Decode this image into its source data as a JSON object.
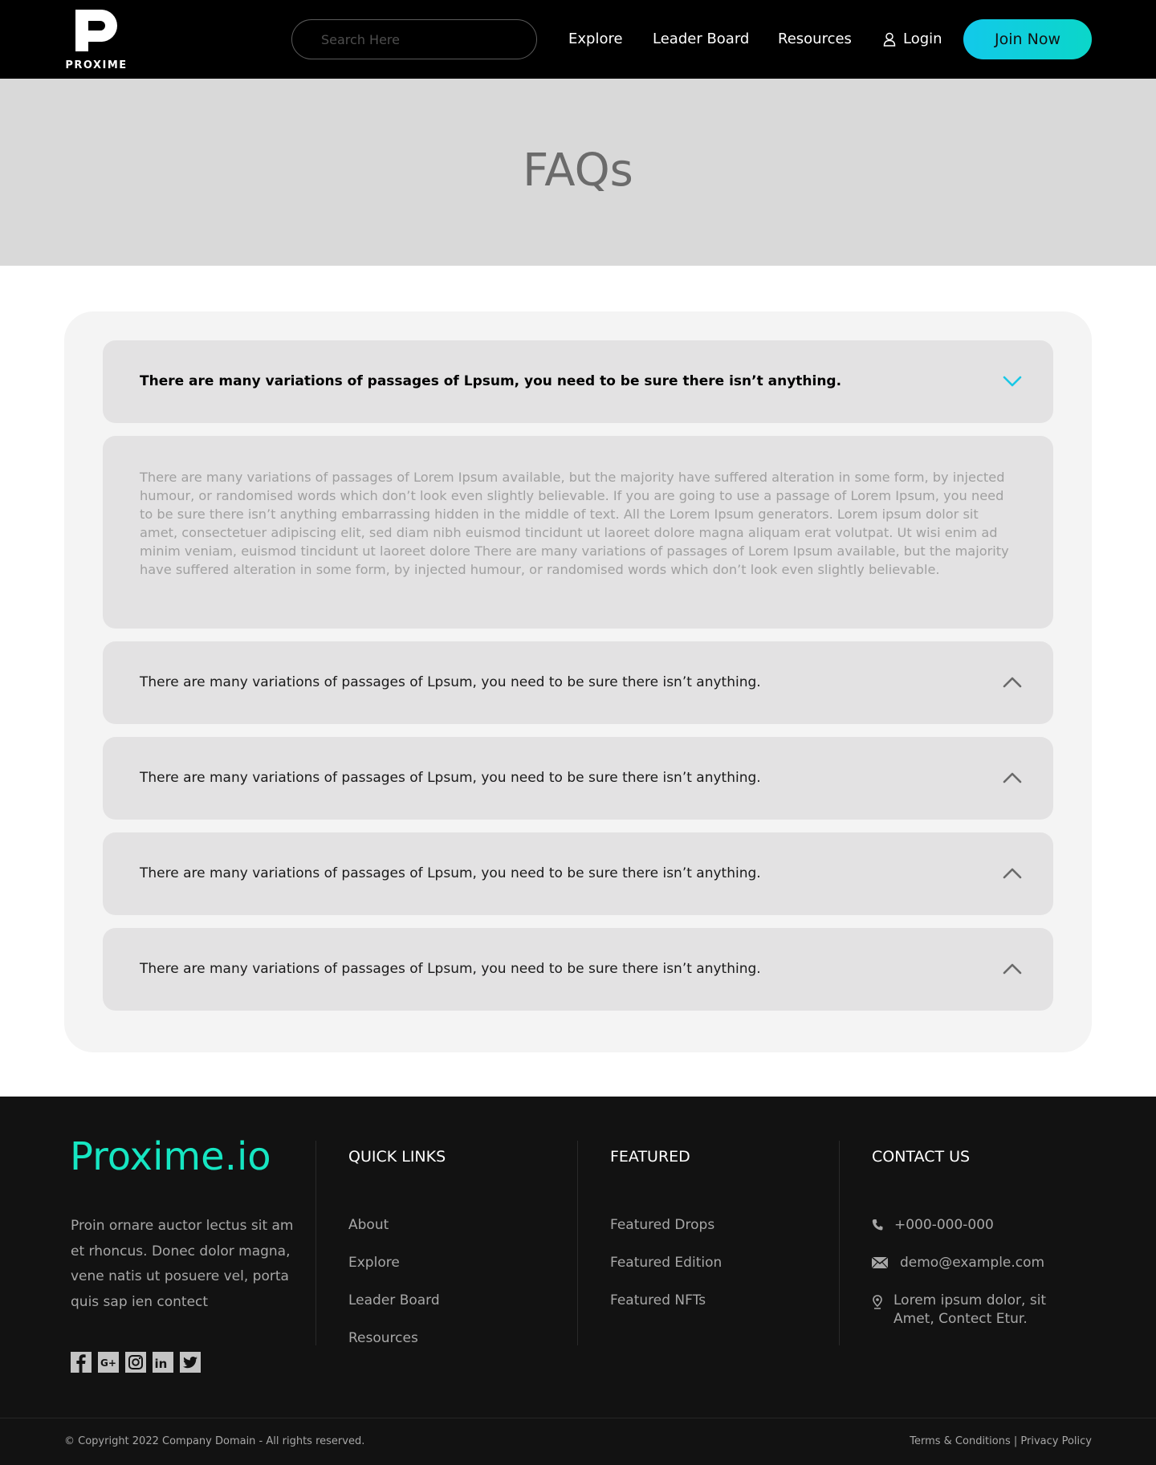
{
  "header": {
    "logo_text": "PROXIME",
    "search_placeholder": "Search Here",
    "nav": [
      "Explore",
      "Leader Board",
      "Resources"
    ],
    "login_label": "Login",
    "join_label": "Join Now"
  },
  "hero": {
    "title": "FAQs"
  },
  "faq": {
    "accent_color": "#1ac8e6",
    "items": [
      {
        "question": "There are many variations of passages of Lpsum, you need to be sure there isn’t anything.",
        "expanded": true,
        "icon": "chevron-down-icon"
      },
      {
        "question": "There are many variations of passages of Lpsum, you need to be sure there isn’t anything.",
        "expanded": false,
        "icon": "chevron-up-icon"
      },
      {
        "question": "There are many variations of passages of Lpsum, you need to be sure there isn’t anything.",
        "expanded": false,
        "icon": "chevron-up-icon"
      },
      {
        "question": "There are many variations of passages of Lpsum, you need to be sure there isn’t anything.",
        "expanded": false,
        "icon": "chevron-up-icon"
      },
      {
        "question": "There are many variations of passages of Lpsum, you need to be sure there isn’t anything.",
        "expanded": false,
        "icon": "chevron-up-icon"
      }
    ],
    "answer": "There are many variations of passages of Lorem Ipsum available, but the majority have suffered alteration in some form, by injected humour, or randomised words which don’t look even slightly believable. If you are going to use a passage of Lorem Ipsum, you need to be sure there isn’t anything embarrassing hidden in the middle of text. All the Lorem Ipsum generators. Lorem ipsum dolor sit amet, consectetuer adipiscing elit, sed diam nibh euismod tincidunt ut laoreet dolore magna aliquam erat volutpat. Ut wisi enim ad minim veniam, euismod tincidunt ut laoreet dolore There are many variations of passages of Lorem Ipsum available, but the majority have suffered alteration in some form, by injected humour, or randomised words which don’t look even slightly believable."
  },
  "footer": {
    "brand": "Proxime.io",
    "brand_color": "#16e6c2",
    "about": "Proin ornare auctor lectus sit am et rhoncus. Donec dolor magna, vene natis ut posuere vel, porta quis sap ien contect",
    "socials": [
      "facebook-icon",
      "google-plus-icon",
      "instagram-icon",
      "linkedin-icon",
      "twitter-icon"
    ],
    "quick_links": {
      "title": "QUICK LINKS",
      "items": [
        "About",
        "Explore",
        "Leader Board",
        "Resources"
      ]
    },
    "featured": {
      "title": "FEATURED",
      "items": [
        "Featured Drops",
        "Featured Edition",
        "Featured NFTs"
      ]
    },
    "contact": {
      "title": "CONTACT US",
      "phone": "+000-000-000",
      "email": "demo@example.com",
      "address_line1": "Lorem ipsum dolor, sit",
      "address_line2": "Amet, Contect Etur."
    },
    "copyright": "© Copyright 2022 Company Domain - All rights reserved.",
    "terms": "Terms & Conditions",
    "separator": " | ",
    "privacy": "Privacy Policy"
  }
}
